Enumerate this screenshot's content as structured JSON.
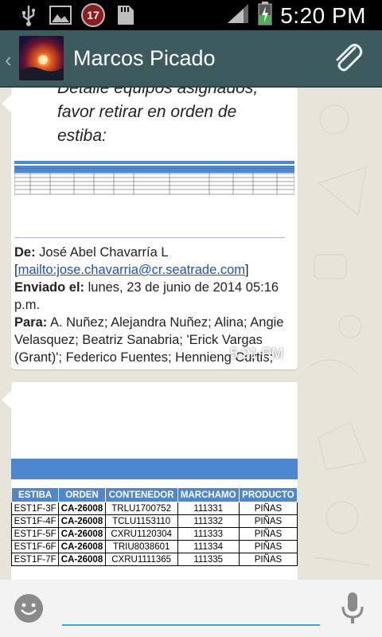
{
  "status": {
    "notification_count": "17",
    "time": "5:20 PM",
    "icons": [
      "usb-icon",
      "image-icon",
      "sd-card-icon",
      "signal-icon",
      "battery-charging-icon"
    ]
  },
  "header": {
    "contact_name": "Marcos Picado",
    "icons": [
      "back-chevron-icon",
      "attach-icon"
    ]
  },
  "message1": {
    "lines": [
      "Detalle equipos asignados,",
      "favor retirar en orden de",
      "estiba:"
    ],
    "from_label": "De:",
    "from_name": " José Abel Chavarría L",
    "email_link": "mailto:jose.chavarria@cr.seatrade.com",
    "email_open": "[",
    "email_close": "]",
    "sent_label": "Enviado el:",
    "sent_value": " lunes, 23 de junio de 2014 05:16 p.m.",
    "to_label": "Para:",
    "to_value": " A. Nuñez; Alejandra Nuñez; Alina; Angie Velasquez; Beatriz Sanabria; 'Erick Vargas (Grant)'; Federico Fuentes; Hennieng Curtis; Juan Miranda; Kembly (Grant); Luis Soto;",
    "time": "5:21 PM"
  },
  "message2": {
    "columns": [
      "ESTIBA",
      "ORDEN",
      "CONTENEDOR",
      "MARCHAMO",
      "PRODUCTO"
    ],
    "rows": [
      [
        "EST1F-3F",
        "CA-26008",
        "TRLU1700752",
        "111331",
        "PIÑAS"
      ],
      [
        "EST1F-4F",
        "CA-26008",
        "TCLU1153110",
        "111332",
        "PIÑAS"
      ],
      [
        "EST1F-5F",
        "CA-26008",
        "CXRU1120304",
        "111333",
        "PIÑAS"
      ],
      [
        "EST1F-6F",
        "CA-26008",
        "TRIU8038601",
        "111334",
        "PIÑAS"
      ],
      [
        "EST1F-7F",
        "CA-26008",
        "CXRU1111365",
        "111335",
        "PIÑAS"
      ]
    ]
  },
  "input": {
    "placeholder": "",
    "icons": [
      "emoji-icon",
      "microphone-icon"
    ]
  },
  "colors": {
    "action_bar": "#3d5a5f",
    "status_bar": "#000000",
    "table_header": "#4d88cf",
    "input_underline": "#3ba7cf"
  }
}
